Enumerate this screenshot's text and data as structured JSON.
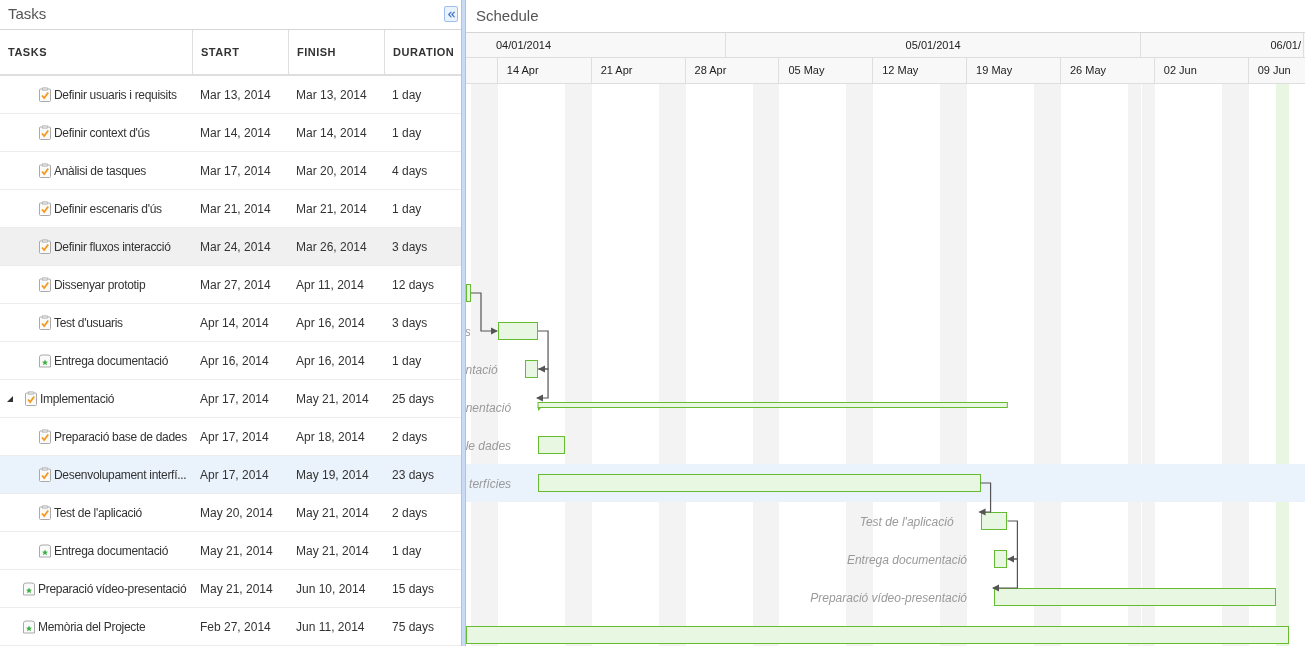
{
  "tasks_panel": {
    "title": "Tasks",
    "columns": [
      "TASKS",
      "START",
      "FINISH",
      "DURATION"
    ]
  },
  "schedule_panel": {
    "title": "Schedule",
    "months": [
      "04/01/2014",
      "05/01/2014",
      "06/01/"
    ],
    "weeks": [
      "14 Apr",
      "21 Apr",
      "28 Apr",
      "05 May",
      "12 May",
      "19 May",
      "26 May",
      "02 Jun",
      "09 Jun"
    ],
    "today_marker": true
  },
  "continued_children": [
    {
      "name": "Definir usuaris i requisits",
      "start": "Mar 13, 2014",
      "finish": "Mar 13, 2014",
      "duration": "1 day",
      "kind": "task",
      "selected": false,
      "highlighted": false
    },
    {
      "name": "Definir context d'ús",
      "start": "Mar 14, 2014",
      "finish": "Mar 14, 2014",
      "duration": "1 day",
      "kind": "task",
      "selected": false,
      "highlighted": false
    },
    {
      "name": "Anàlisi de tasques",
      "start": "Mar 17, 2014",
      "finish": "Mar 20, 2014",
      "duration": "4 days",
      "kind": "task",
      "selected": false,
      "highlighted": false
    },
    {
      "name": "Definir escenaris d'ús",
      "start": "Mar 21, 2014",
      "finish": "Mar 21, 2014",
      "duration": "1 day",
      "kind": "task",
      "selected": false,
      "highlighted": false
    },
    {
      "name": "Definir fluxos interacció",
      "start": "Mar 24, 2014",
      "finish": "Mar 26, 2014",
      "duration": "3 days",
      "kind": "task",
      "selected": false,
      "highlighted": true
    },
    {
      "name": "Dissenyar prototip",
      "start": "Mar 27, 2014",
      "finish": "Apr 11, 2014",
      "duration": "12 days",
      "kind": "task",
      "selected": false,
      "highlighted": false
    },
    {
      "name": "Test d'usuaris",
      "start": "Apr 14, 2014",
      "finish": "Apr 16, 2014",
      "duration": "3 days",
      "kind": "task",
      "selected": false,
      "highlighted": false,
      "bar_label": "s",
      "linked_from_previous": true
    },
    {
      "name": "Entrega documentació",
      "start": "Apr 16, 2014",
      "finish": "Apr 16, 2014",
      "duration": "1 day",
      "kind": "milestone",
      "selected": false,
      "highlighted": false,
      "bar_label": "ntació",
      "linked_from_previous": true
    }
  ],
  "rows": [
    {
      "name": "Implementació",
      "start": "Apr 17, 2014",
      "finish": "May 21, 2014",
      "duration": "25 days",
      "kind": "summary",
      "selected": false,
      "highlighted": false,
      "expanded": true,
      "bar_label": "nentació",
      "linked_from_previous": true,
      "children": [
        {
          "name": "Preparació base de dades",
          "start": "Apr 17, 2014",
          "finish": "Apr 18, 2014",
          "duration": "2 days",
          "kind": "task",
          "selected": false,
          "highlighted": false,
          "bar_label": "le dades"
        },
        {
          "name": "Desenvolupament interfí...",
          "start": "Apr 17, 2014",
          "finish": "May 19, 2014",
          "duration": "23 days",
          "kind": "task",
          "selected": true,
          "highlighted": false,
          "bar_label": "terfícies"
        },
        {
          "name": "Test de l'aplicació",
          "start": "May 20, 2014",
          "finish": "May 21, 2014",
          "duration": "2 days",
          "kind": "task",
          "selected": false,
          "highlighted": false,
          "bar_label": "Test de l'aplicació",
          "linked_from_previous": true
        },
        {
          "name": "Entrega documentació",
          "start": "May 21, 2014",
          "finish": "May 21, 2014",
          "duration": "1 day",
          "kind": "milestone",
          "selected": false,
          "highlighted": false,
          "bar_label": "Entrega documentació",
          "linked_from_previous": true
        }
      ]
    },
    {
      "name": "Preparació vídeo-presentació",
      "start": "May 21, 2014",
      "finish": "Jun 10, 2014",
      "duration": "15 days",
      "kind": "milestone",
      "selected": false,
      "highlighted": false,
      "bar_label": "Preparació vídeo-presentació",
      "linked_from_previous": true
    },
    {
      "name": "Memòria del Projecte",
      "start": "Feb 27, 2014",
      "finish": "Jun 11, 2014",
      "duration": "75 days",
      "kind": "milestone",
      "selected": false,
      "highlighted": false
    }
  ]
}
